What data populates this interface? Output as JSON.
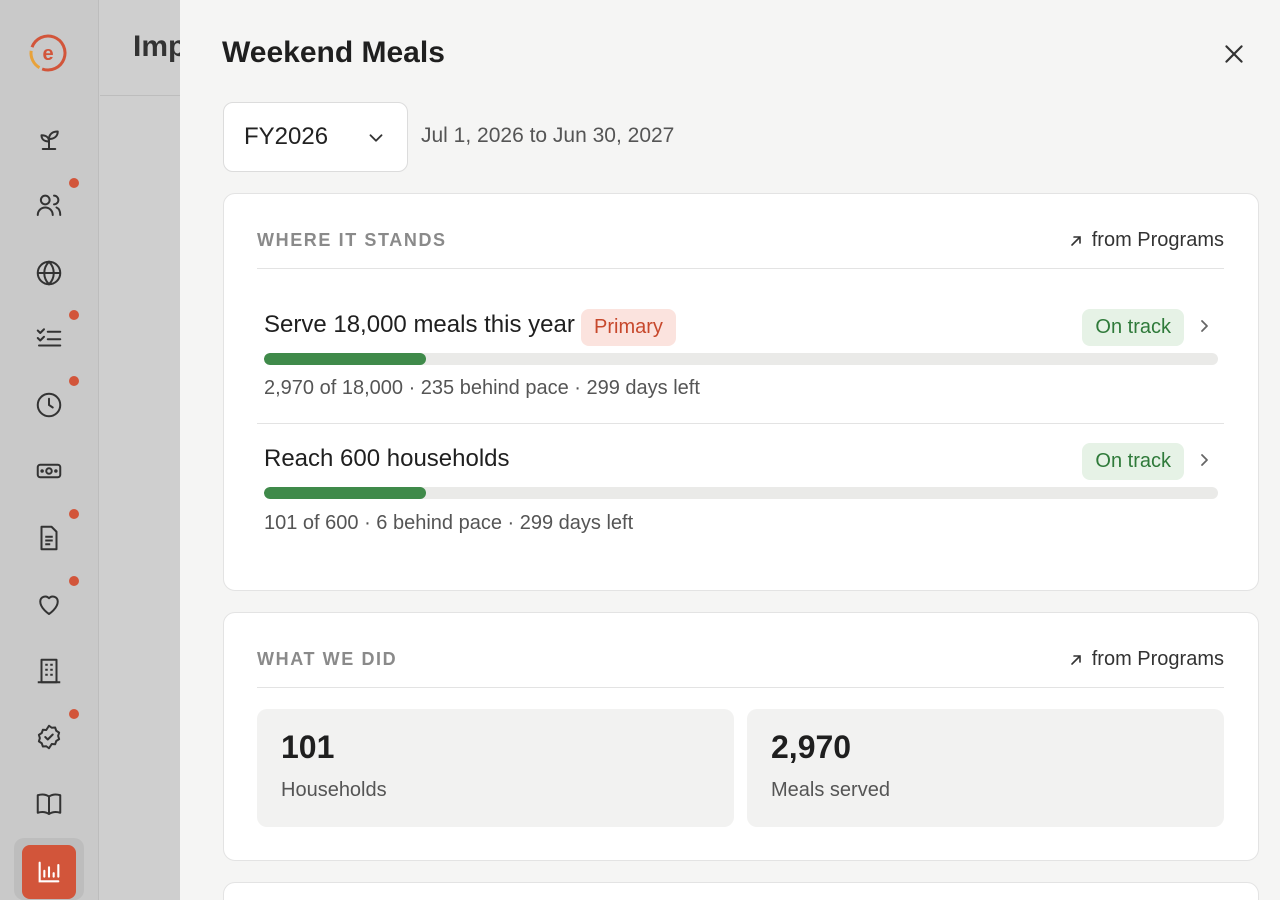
{
  "background": {
    "page_title": "Imp"
  },
  "sidebar": {
    "accent": "#d2553a",
    "items": [
      {
        "icon": "sprout-icon"
      },
      {
        "icon": "users-icon",
        "notify": true
      },
      {
        "icon": "globe-icon"
      },
      {
        "icon": "checklist-icon",
        "notify": true
      },
      {
        "icon": "clock-icon",
        "notify": true
      },
      {
        "icon": "money-icon"
      },
      {
        "icon": "document-icon",
        "notify": true
      },
      {
        "icon": "heart-icon",
        "notify": true
      },
      {
        "icon": "building-icon"
      },
      {
        "icon": "badge-check-icon",
        "notify": true
      },
      {
        "icon": "book-icon"
      },
      {
        "icon": "bar-chart-icon",
        "active": true
      }
    ]
  },
  "drawer": {
    "title": "Weekend Meals",
    "period_select": {
      "value": "FY2026"
    },
    "date_range": "Jul 1, 2026 to Jun 30, 2027",
    "where_it_stands": {
      "label": "WHERE IT STANDS",
      "source": "from Programs",
      "goals": [
        {
          "title": "Serve 18,000 meals this year",
          "badge": "Primary",
          "status": "On track",
          "progress": 0.17,
          "meta": "2,970 of 18,000 · 235 behind pace · 299 days left"
        },
        {
          "title": "Reach 600 households",
          "badge": "",
          "status": "On track",
          "progress": 0.17,
          "meta": "101 of 600 · 6 behind pace · 299 days left"
        }
      ]
    },
    "what_we_did": {
      "label": "WHAT WE DID",
      "source": "from Programs",
      "stats": [
        {
          "value": "101",
          "label": "Households"
        },
        {
          "value": "2,970",
          "label": "Meals served"
        }
      ]
    }
  }
}
